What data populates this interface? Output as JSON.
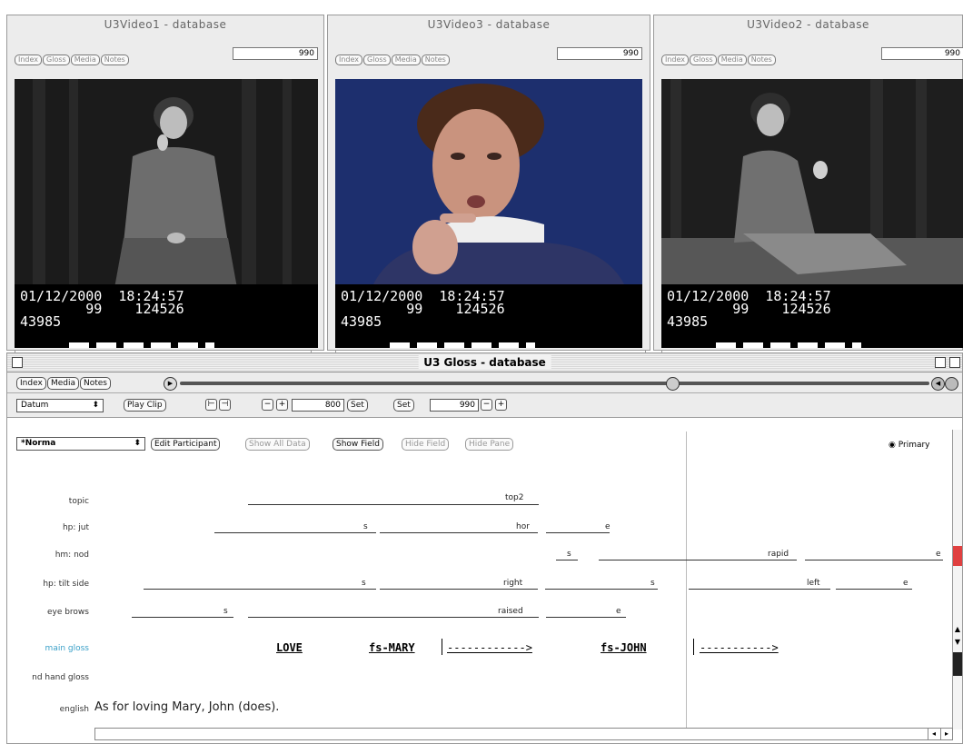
{
  "videos": [
    {
      "title": "U3Video1 - database",
      "buttons": [
        "Index",
        "Gloss",
        "Media",
        "Notes"
      ],
      "frame_counter": "990",
      "overlay_line1": "01/12/2000  18:24:57",
      "overlay_line2": "        99    124526",
      "overlay_line3": "43985"
    },
    {
      "title": "U3Video3 - database",
      "buttons": [
        "Index",
        "Gloss",
        "Media",
        "Notes"
      ],
      "frame_counter": "990",
      "overlay_line1": "01/12/2000  18:24:57",
      "overlay_line2": "        99    124526",
      "overlay_line3": "43985"
    },
    {
      "title": "U3Video2 - database",
      "buttons": [
        "Index",
        "Gloss",
        "Media",
        "Notes"
      ],
      "frame_counter": "990",
      "overlay_line1": "01/12/2000  18:24:57",
      "overlay_line2": "        99    124526",
      "overlay_line3": "43985"
    }
  ],
  "gloss_window": {
    "title": "U3 Gloss - database",
    "tab_buttons": [
      "Index",
      "Media",
      "Notes"
    ],
    "datum_select": "Datum",
    "play_clip": "Play Clip",
    "start_frame": "800",
    "set1": "Set",
    "set2": "Set",
    "end_frame": "990",
    "participant_select": "*Norma",
    "edit_participant": "Edit Participant",
    "show_all_data": "Show All Data",
    "show_field": "Show Field",
    "hide_field": "Hide Field",
    "hide_pane": "Hide Pane",
    "primary_label": "Primary",
    "tiers": [
      {
        "label": "topic",
        "values": [
          "top2"
        ]
      },
      {
        "label": "hp: jut",
        "values": [
          "s",
          "hor",
          "e"
        ]
      },
      {
        "label": "hm: nod",
        "values": [
          "s",
          "rapid",
          "e"
        ]
      },
      {
        "label": "hp: tilt side",
        "values": [
          "s",
          "right",
          "s",
          "left",
          "e"
        ]
      },
      {
        "label": "eye brows",
        "values": [
          "s",
          "raised",
          "e"
        ]
      },
      {
        "label": "main gloss",
        "values": [
          "LOVE",
          "fs-MARY",
          "------------>",
          "fs-JOHN",
          "----------->"
        ]
      },
      {
        "label": "nd hand gloss",
        "values": []
      },
      {
        "label": "english",
        "values": [
          "As for loving Mary, John (does)."
        ]
      }
    ]
  },
  "colors": {
    "main_gloss_label": "#3aa0c8",
    "scroll_accent": "#e04040"
  }
}
